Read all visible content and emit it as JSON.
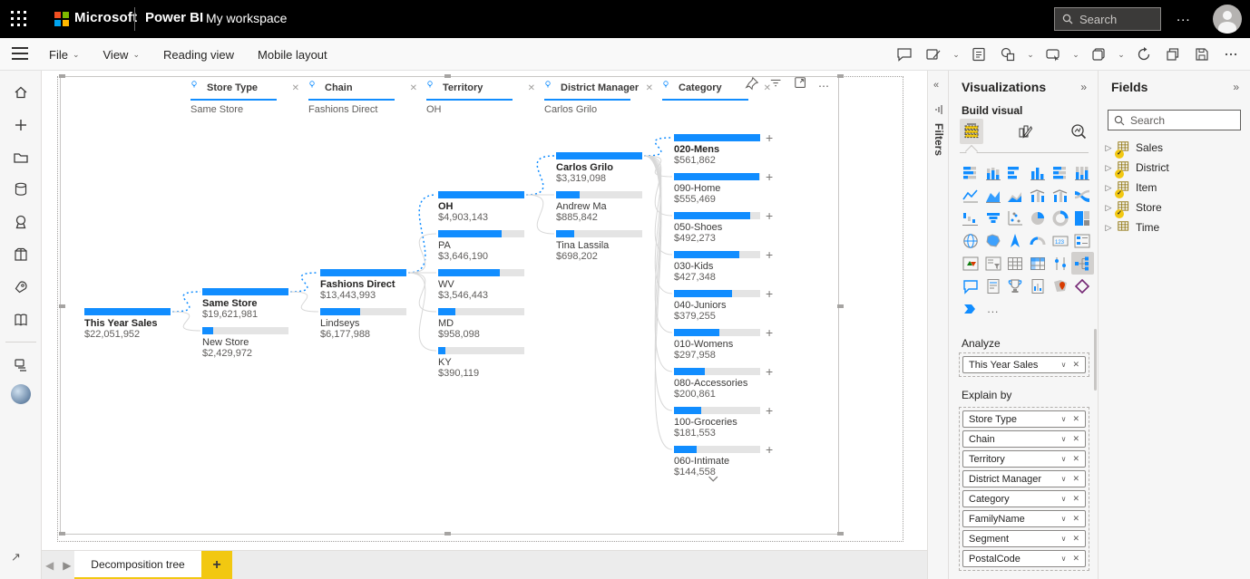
{
  "topbar": {
    "brand": "Microsoft",
    "product": "Power BI",
    "workspace": "My workspace",
    "search_placeholder": "Search",
    "more": "...",
    "icons": [
      "waffle-icon",
      "search-icon",
      "more-icon",
      "avatar"
    ]
  },
  "menubar": {
    "items": [
      {
        "label": "File",
        "chevron": true
      },
      {
        "label": "View",
        "chevron": true
      },
      {
        "label": "Reading view",
        "chevron": false
      },
      {
        "label": "Mobile layout",
        "chevron": false
      }
    ],
    "right_icons": [
      {
        "name": "comment-icon",
        "chevron": false
      },
      {
        "name": "text-box-icon",
        "chevron": true
      },
      {
        "name": "notes-icon",
        "chevron": false
      },
      {
        "name": "shapes-icon",
        "chevron": true
      },
      {
        "name": "visual-callout-icon",
        "chevron": true
      },
      {
        "name": "buttons-icon",
        "chevron": true
      },
      {
        "name": "refresh-icon",
        "chevron": false
      },
      {
        "name": "duplicate-icon",
        "chevron": false
      },
      {
        "name": "save-icon",
        "chevron": false
      },
      {
        "name": "more-options-icon",
        "chevron": false
      }
    ]
  },
  "sidebar": {
    "icons": [
      "home-icon",
      "create-icon",
      "browse-icon",
      "data-hub-icon",
      "metrics-icon",
      "apps-icon",
      "deployment-icon",
      "learn-icon",
      "workspaces-icon"
    ],
    "expand_arrow": "↗"
  },
  "visual_toolbar": {
    "icons": [
      "pin-icon",
      "filter-icon",
      "focus-mode-icon",
      "more-options-icon"
    ]
  },
  "chart_data": {
    "type": "decomposition-tree",
    "measure": "This Year Sales",
    "root": {
      "label": "This Year Sales",
      "value": "$22,051,952"
    },
    "levels": [
      {
        "field": "Store Type",
        "selected_value": "Same Store",
        "nodes": [
          {
            "label": "Same Store",
            "value": "$19,621,981",
            "pct": 100,
            "selected": true
          },
          {
            "label": "New Store",
            "value": "$2,429,972",
            "pct": 12.4
          }
        ]
      },
      {
        "field": "Chain",
        "selected_value": "Fashions Direct",
        "nodes": [
          {
            "label": "Fashions Direct",
            "value": "$13,443,993",
            "pct": 100,
            "selected": true
          },
          {
            "label": "Lindseys",
            "value": "$6,177,988",
            "pct": 46
          }
        ]
      },
      {
        "field": "Territory",
        "selected_value": "OH",
        "nodes": [
          {
            "label": "OH",
            "value": "$4,903,143",
            "pct": 100,
            "selected": true
          },
          {
            "label": "PA",
            "value": "$3,646,190",
            "pct": 74
          },
          {
            "label": "WV",
            "value": "$3,546,443",
            "pct": 72
          },
          {
            "label": "MD",
            "value": "$958,098",
            "pct": 20
          },
          {
            "label": "KY",
            "value": "$390,119",
            "pct": 8
          }
        ]
      },
      {
        "field": "District Manager",
        "selected_value": "Carlos Grilo",
        "nodes": [
          {
            "label": "Carlos Grilo",
            "value": "$3,319,098",
            "pct": 100,
            "selected": true
          },
          {
            "label": "Andrew Ma",
            "value": "$885,842",
            "pct": 27
          },
          {
            "label": "Tina Lassila",
            "value": "$698,202",
            "pct": 21
          }
        ]
      },
      {
        "field": "Category",
        "selected_value": "",
        "expandable": true,
        "has_more": true,
        "nodes": [
          {
            "label": "020-Mens",
            "value": "$561,862",
            "pct": 100,
            "selected": true
          },
          {
            "label": "090-Home",
            "value": "$555,469",
            "pct": 99
          },
          {
            "label": "050-Shoes",
            "value": "$492,273",
            "pct": 88
          },
          {
            "label": "030-Kids",
            "value": "$427,348",
            "pct": 76
          },
          {
            "label": "040-Juniors",
            "value": "$379,255",
            "pct": 67
          },
          {
            "label": "010-Womens",
            "value": "$297,958",
            "pct": 53
          },
          {
            "label": "080-Accessories",
            "value": "$200,861",
            "pct": 36
          },
          {
            "label": "100-Groceries",
            "value": "$181,553",
            "pct": 32
          },
          {
            "label": "060-Intimate",
            "value": "$144,558",
            "pct": 26
          }
        ]
      }
    ]
  },
  "filters_panel": {
    "title": "Filters",
    "collapse_icon": "«"
  },
  "visualizations_panel": {
    "title": "Visualizations",
    "expand_icon": "»",
    "build_label": "Build visual",
    "tabs": [
      "build-visual-tab",
      "format-visual-tab",
      "analytics-tab"
    ],
    "gallery": [
      "stacked-bar-chart",
      "stacked-column-chart",
      "clustered-bar-chart",
      "clustered-column-chart",
      "100-stacked-bar-chart",
      "100-stacked-column-chart",
      "line-chart",
      "area-chart",
      "stacked-area-chart",
      "line-and-stacked-column-chart",
      "line-and-clustered-column-chart",
      "ribbon-chart",
      "waterfall-chart",
      "funnel-chart",
      "scatter-chart",
      "pie-chart",
      "donut-chart",
      "treemap",
      "map",
      "filled-map",
      "azure-map",
      "gauge",
      "card",
      "multi-row-card",
      "kpi",
      "slicer",
      "table",
      "matrix",
      "key-influencers",
      "decomposition-tree",
      "qa-visual",
      "smart-narrative",
      "goals",
      "paginated-report",
      "arcgis-map",
      "power-apps",
      "power-automate"
    ],
    "selected_visual": "decomposition-tree",
    "more_visuals": "...",
    "analyze_label": "Analyze",
    "analyze_fields": [
      "This Year Sales"
    ],
    "explain_label": "Explain by",
    "explain_fields": [
      "Store Type",
      "Chain",
      "Territory",
      "District Manager",
      "Category",
      "FamilyName",
      "Segment",
      "PostalCode"
    ]
  },
  "fields_panel": {
    "title": "Fields",
    "expand_icon": "»",
    "search_placeholder": "Search",
    "tables": [
      {
        "name": "Sales",
        "checked": true
      },
      {
        "name": "District",
        "checked": true
      },
      {
        "name": "Item",
        "checked": true
      },
      {
        "name": "Store",
        "checked": true
      },
      {
        "name": "Time",
        "checked": false
      }
    ]
  },
  "footer": {
    "page_tab": "Decomposition tree",
    "add_tab": "+"
  },
  "colors": {
    "accent_blue": "#118DFF",
    "brand_yellow": "#F2C811",
    "bar_track": "#e4e4e4"
  }
}
